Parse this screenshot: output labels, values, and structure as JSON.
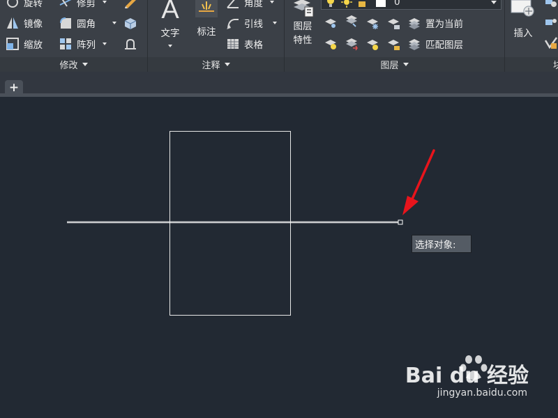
{
  "ribbon": {
    "modify": {
      "title": "修改",
      "rotate_label": "旋转",
      "trim_label": "修剪",
      "mirror_label": "镜像",
      "fillet_label": "圆角",
      "scale_label": "缩放",
      "array_label": "阵列"
    },
    "annotation": {
      "title": "注释",
      "text_label": "文字",
      "dimension_label": "标注",
      "angle_label": "角度",
      "leader_label": "引线",
      "table_label": "表格"
    },
    "layers": {
      "title": "图层",
      "properties_label_1": "图层",
      "properties_label_2": "特性",
      "current_layer": "0",
      "set_current_label": "置为当前",
      "match_layer_label": "匹配图层"
    },
    "block": {
      "insert_label": "插入",
      "title_partial": "块"
    }
  },
  "tabs": {
    "add_label": "+"
  },
  "canvas": {
    "tooltip": "选择对象:",
    "colors": {
      "background": "#222933",
      "geometry": "#e8e8e8",
      "arrow": "#e8141c"
    }
  },
  "watermark": {
    "brand": "Bai du 经验",
    "url": "jingyan.baidu.com"
  }
}
